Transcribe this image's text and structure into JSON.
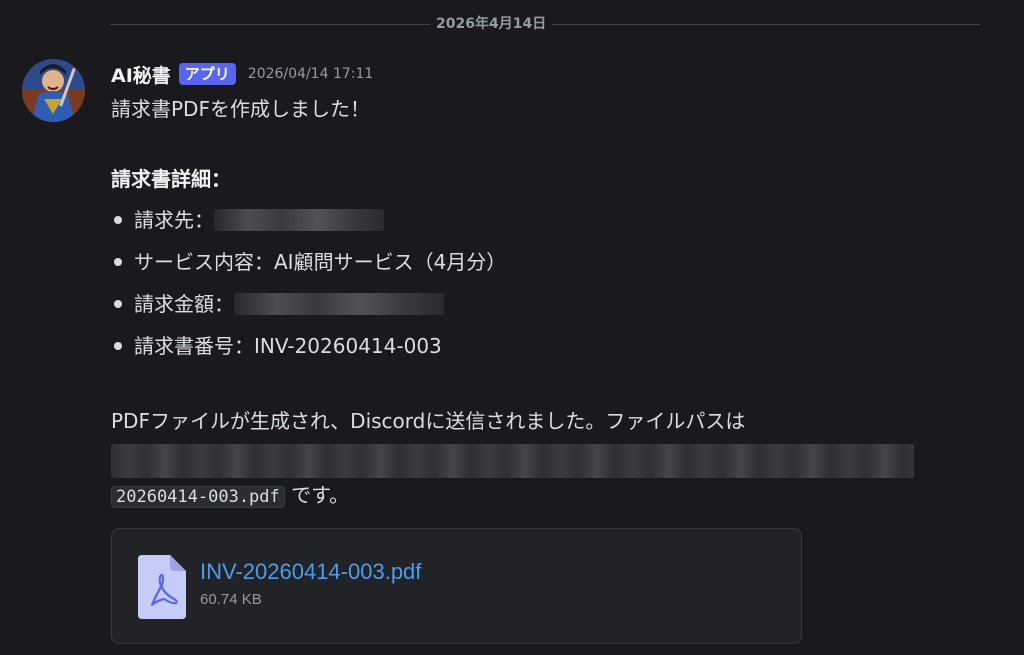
{
  "date_divider": "2026年4月14日",
  "message": {
    "author": "AI秘書",
    "badge": "アプリ",
    "timestamp": "2026/04/14 17:11",
    "intro": "請求書PDFを作成しました！",
    "details_heading": "請求書詳細：",
    "bullets": [
      {
        "label": "請求先："
      },
      {
        "label": "サービス内容：AI顧問サービス（4月分）"
      },
      {
        "label": "請求金額："
      },
      {
        "label": "請求書番号：INV-20260414-003"
      }
    ],
    "file_sentence": "PDFファイルが生成され、Discordに送信されました。ファイルパスは",
    "path_code": "20260414-003.pdf",
    "path_suffix": " です。"
  },
  "attachment": {
    "file_name": "INV-20260414-003.pdf",
    "file_size": "60.74 KB",
    "icon": "pdf-file-icon"
  },
  "colors": {
    "background": "#1a1a1e",
    "badge": "#5865f2",
    "link": "#4a9ded"
  }
}
